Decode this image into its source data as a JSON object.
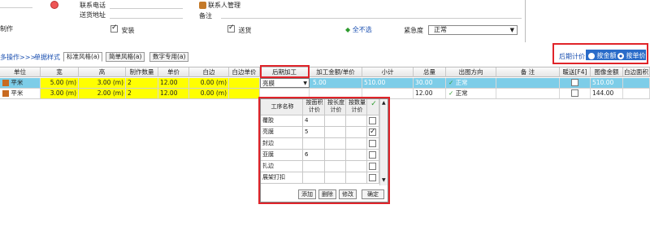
{
  "top": {
    "phone_label": "联系电话",
    "address_label": "送货地址",
    "contact_mgmt": "联系人管理",
    "remark_label": "备注",
    "chk_make": {
      "label": "制作",
      "checked": true
    },
    "chk_install": {
      "label": "安装",
      "checked": true
    },
    "chk_deliver": {
      "label": "送货",
      "checked": true
    },
    "select_none": "全不选",
    "urgency_label": "紧急度",
    "urgency_value": "正常"
  },
  "toolbar": {
    "multi_ops": "多操作>>>",
    "style_label": "单据样式",
    "tabs": [
      "标准风格(a)",
      "简单风格(a)",
      "数字专用(a)"
    ],
    "pricing_label": "后期计价",
    "pricing_options": [
      {
        "label": "按金额",
        "selected": false
      },
      {
        "label": "按单价",
        "selected": true
      }
    ]
  },
  "table": {
    "headers": [
      "单位",
      "宽",
      "高",
      "制作数量",
      "单价",
      "白边",
      "白边单价",
      "后期加工",
      "加工金额/单价",
      "小计",
      "总量",
      "出图方向",
      "备 注",
      "暖送[F4]",
      "图像金额",
      "白边面积"
    ],
    "rows": [
      {
        "unit": "平米",
        "width": "5.00 (m)",
        "height": "3.00 (m)",
        "qty": "2",
        "price": "12.00",
        "border": "0.00 (m)",
        "border_price": "",
        "post": "亮膜",
        "proc": "5.00",
        "subtotal": "510.00",
        "total": "30.00",
        "direction": "正常",
        "note": "",
        "warm": false,
        "image_amount": "510.00",
        "border_area": ""
      },
      {
        "unit": "平米",
        "width": "3.00 (m)",
        "height": "2.00 (m)",
        "qty": "2",
        "price": "12.00",
        "border": "0.00 (m)",
        "border_price": "",
        "post": "",
        "proc": "",
        "subtotal": "",
        "total": "12.00",
        "direction": "正常",
        "note": "",
        "warm": false,
        "image_amount": "144.00",
        "border_area": ""
      }
    ]
  },
  "popup": {
    "headers": [
      "工序名称",
      "按面积计价",
      "按长度计价",
      "按数量计价"
    ],
    "rows": [
      {
        "name": "覆胶",
        "area": "4",
        "checked": false
      },
      {
        "name": "亮膜",
        "area": "5",
        "checked": true
      },
      {
        "name": "封边",
        "area": "",
        "checked": false
      },
      {
        "name": "亚膜",
        "area": "6",
        "checked": false
      },
      {
        "name": "扎边",
        "area": "",
        "checked": false
      },
      {
        "name": "展架打扣",
        "area": "",
        "checked": false
      }
    ],
    "buttons": [
      "添加",
      "删除",
      "修改",
      "确定"
    ]
  },
  "colors": {
    "yellow": "#ffff00",
    "selected_row": "#7dcde8",
    "highlight": "#e0242a",
    "link": "#1a4fb0",
    "ok_green": "#2e9b2e"
  }
}
